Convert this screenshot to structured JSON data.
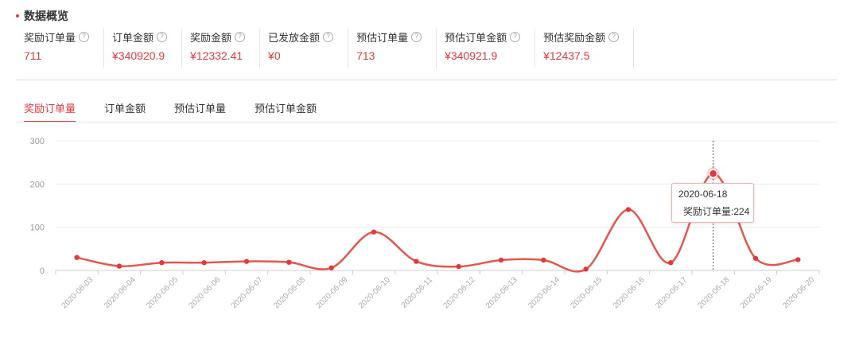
{
  "section": {
    "title": "数据概览"
  },
  "metrics": [
    {
      "label": "奖励订单量",
      "value": "711"
    },
    {
      "label": "订单金额",
      "value": "¥340920.9"
    },
    {
      "label": "奖励金额",
      "value": "¥12332.41"
    },
    {
      "label": "已发放金额",
      "value": "¥0"
    },
    {
      "label": "预估订单量",
      "value": "713"
    },
    {
      "label": "预估订单金额",
      "value": "¥340921.9"
    },
    {
      "label": "预估奖励金额",
      "value": "¥12437.5"
    }
  ],
  "help_icon_glyph": "?",
  "tabs": [
    {
      "label": "奖励订单量",
      "active": true
    },
    {
      "label": "订单金额",
      "active": false
    },
    {
      "label": "预估订单量",
      "active": false
    },
    {
      "label": "预估订单金额",
      "active": false
    }
  ],
  "tooltip": {
    "date": "2020-06-18",
    "series_label": "奖励订单量",
    "value": "224"
  },
  "colors": {
    "accent": "#e4393c",
    "line": "#e4574c"
  },
  "chart_data": {
    "type": "line",
    "x": [
      "2020-06-03",
      "2020-06-04",
      "2020-06-05",
      "2020-06-06",
      "2020-06-07",
      "2020-06-08",
      "2020-06-09",
      "2020-06-10",
      "2020-06-11",
      "2020-06-12",
      "2020-06-13",
      "2020-06-14",
      "2020-06-15",
      "2020-06-16",
      "2020-06-17",
      "2020-06-18",
      "2020-06-19",
      "2020-06-20"
    ],
    "series": [
      {
        "name": "奖励订单量",
        "values": [
          30,
          10,
          18,
          18,
          21,
          19,
          6,
          89,
          21,
          9,
          24,
          24,
          3,
          141,
          18,
          224,
          28,
          25
        ]
      }
    ],
    "yticks": [
      0,
      100,
      200,
      300
    ],
    "ylim": [
      0,
      300
    ],
    "highlight_index": 15,
    "grid": true
  }
}
